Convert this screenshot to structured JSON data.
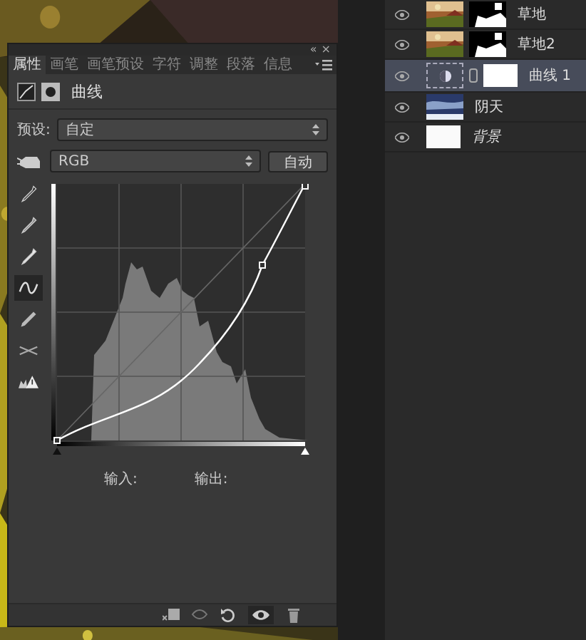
{
  "panel": {
    "header_buttons": [
      "«",
      "×"
    ],
    "tabs": [
      {
        "label": "属性",
        "selected": true
      },
      {
        "label": "画笔",
        "selected": false
      },
      {
        "label": "画笔预设",
        "selected": false
      },
      {
        "label": "字符",
        "selected": false
      },
      {
        "label": "调整",
        "selected": false
      },
      {
        "label": "段落",
        "selected": false
      },
      {
        "label": "信息",
        "selected": false
      }
    ],
    "title": "曲线",
    "preset": {
      "label": "预设:",
      "value": "自定"
    },
    "channel": {
      "value": "RGB"
    },
    "auto_button": "自动",
    "tools": [
      {
        "kind": "black-dropper",
        "selected": false
      },
      {
        "kind": "gray-dropper",
        "selected": false
      },
      {
        "kind": "white-dropper",
        "selected": false
      },
      {
        "kind": "curve",
        "selected": true
      },
      {
        "kind": "pencil",
        "selected": false
      },
      {
        "kind": "smooth",
        "selected": false
      },
      {
        "kind": "clipping",
        "selected": false
      }
    ],
    "input_label": "输入:",
    "output_label": "输出:"
  },
  "layers": [
    {
      "name": "草地",
      "selected": false
    },
    {
      "name": "草地2",
      "selected": false
    },
    {
      "name": "曲线 1",
      "kind": "adjustment",
      "selected": true
    },
    {
      "name": "阴天",
      "kind": "sky",
      "selected": false
    },
    {
      "name": "背景",
      "kind": "background",
      "selected": false
    }
  ]
}
